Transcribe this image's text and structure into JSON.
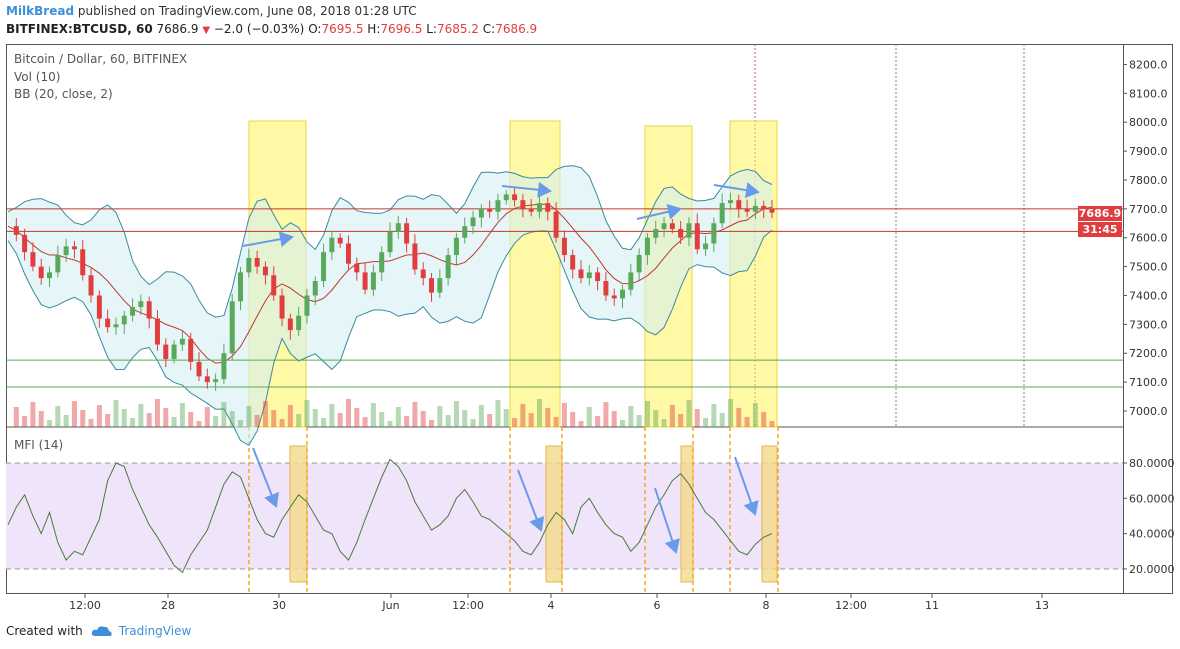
{
  "header": {
    "author": "MilkBread",
    "published_text": "published on TradingView.com, June 08, 2018 01:28 UTC",
    "symbol": "BITFINEX:BTCUSD, 60",
    "last": "7686.9",
    "change": "−2.0 (−0.03%)",
    "o_label": "O:",
    "o_value": "7695.5",
    "h_label": "H:",
    "h_value": "7696.5",
    "l_label": "L:",
    "l_value": "7685.2",
    "c_label": "C:",
    "c_value": "7686.9"
  },
  "legend": {
    "title": "Bitcoin / Dollar, 60, BITFINEX",
    "vol": "Vol (10)",
    "bb": "BB (20, close, 2)",
    "mfi": "MFI (14)"
  },
  "price_tags": {
    "price": "7686.9",
    "countdown": "31:45"
  },
  "footer": {
    "created_with": "Created with",
    "brand": "TradingView"
  },
  "colors": {
    "up": "#5aa85a",
    "down": "#e03e3e",
    "highlight": "#fff35a",
    "mfi_band": "#f0e4fb",
    "bb": "#3a8aa0",
    "arrow": "#6a9be8",
    "marker": "#f5a623"
  },
  "chart_data": [
    {
      "type": "candlestick",
      "title": "Bitcoin / Dollar, 60, BITFINEX",
      "x_ticks": [
        "12:00",
        "28",
        "30",
        "Jun",
        "12:00",
        "4",
        "6",
        "8",
        "12:00",
        "11",
        "13"
      ],
      "y_ticks": [
        "8200.0",
        "8100.0",
        "8000.0",
        "7900.0",
        "7800.0",
        "7700.0",
        "7600.0",
        "7500.0",
        "7400.0",
        "7300.0",
        "7200.0",
        "7100.0",
        "7000.0"
      ],
      "ylim": [
        6950,
        8250
      ],
      "close_series": [
        7640,
        7610,
        7550,
        7500,
        7460,
        7480,
        7540,
        7570,
        7560,
        7470,
        7400,
        7320,
        7290,
        7300,
        7330,
        7360,
        7380,
        7320,
        7230,
        7180,
        7230,
        7250,
        7170,
        7120,
        7100,
        7110,
        7200,
        7380,
        7480,
        7530,
        7500,
        7470,
        7400,
        7320,
        7280,
        7330,
        7400,
        7450,
        7550,
        7600,
        7580,
        7510,
        7480,
        7420,
        7480,
        7550,
        7620,
        7650,
        7580,
        7490,
        7460,
        7410,
        7460,
        7540,
        7600,
        7640,
        7670,
        7700,
        7690,
        7730,
        7750,
        7730,
        7700,
        7690,
        7720,
        7690,
        7600,
        7540,
        7490,
        7460,
        7480,
        7450,
        7400,
        7390,
        7420,
        7480,
        7540,
        7600,
        7630,
        7650,
        7630,
        7600,
        7650,
        7560,
        7580,
        7650,
        7720,
        7730,
        7700,
        7690,
        7710,
        7700,
        7687
      ],
      "horizontal_levels": [
        7700,
        7622,
        7176,
        7083
      ],
      "highlight_zones": [
        "28–30",
        "Jun 3–4",
        "Jun 5–6",
        "Jun 7–8"
      ]
    },
    {
      "type": "line",
      "title": "MFI (14)",
      "y_ticks": [
        "80.0000",
        "60.0000",
        "40.0000",
        "20.0000"
      ],
      "ylim": [
        5,
        95
      ],
      "band": [
        20,
        80
      ],
      "values": [
        45,
        55,
        62,
        50,
        40,
        52,
        35,
        25,
        30,
        28,
        38,
        48,
        70,
        80,
        78,
        65,
        55,
        45,
        38,
        30,
        22,
        18,
        28,
        35,
        42,
        55,
        68,
        75,
        72,
        60,
        48,
        40,
        38,
        48,
        55,
        62,
        58,
        50,
        42,
        40,
        30,
        25,
        35,
        48,
        60,
        72,
        82,
        78,
        70,
        58,
        50,
        42,
        45,
        50,
        60,
        65,
        58,
        50,
        48,
        44,
        40,
        36,
        30,
        28,
        35,
        45,
        52,
        48,
        40,
        55,
        60,
        52,
        45,
        40,
        38,
        30,
        35,
        45,
        55,
        62,
        70,
        74,
        68,
        60,
        52,
        48,
        42,
        36,
        30,
        28,
        34,
        38,
        40
      ]
    }
  ]
}
